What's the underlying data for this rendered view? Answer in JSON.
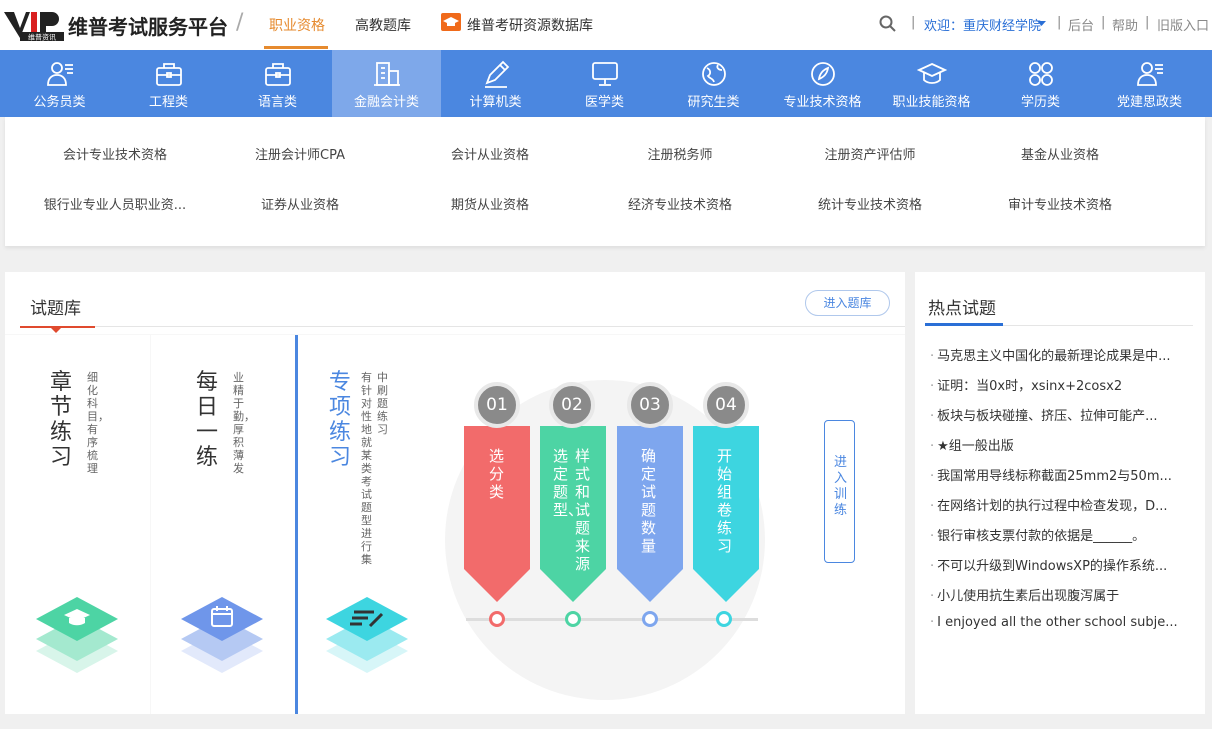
{
  "header": {
    "logo_text": "VIP",
    "logo_sub": "维普资讯",
    "site_name": "维普考试服务平台",
    "nav": [
      "职业资格",
      "高教题库",
      "维普考研资源数据库"
    ],
    "welcome": "欢迎：重庆财经学院",
    "links": [
      "后台",
      "帮助",
      "旧版入口"
    ]
  },
  "categories": [
    "公务员类",
    "工程类",
    "语言类",
    "金融会计类",
    "计算机类",
    "医学类",
    "研究生类",
    "专业技术资格",
    "职业技能资格",
    "学历类",
    "党建思政类"
  ],
  "subcategories": [
    "会计专业技术资格",
    "注册会计师CPA",
    "会计从业资格",
    "注册税务师",
    "注册资产评估师",
    "基金从业资格",
    "银行业专业人员职业资...",
    "证券从业资格",
    "期货从业资格",
    "经济专业技术资格",
    "统计专业技术资格",
    "审计专业技术资格"
  ],
  "question_bank": {
    "title": "试题库",
    "enter_label": "进入题库",
    "cards": [
      {
        "title": "章节练习",
        "desc": "细化科目，有序梳理"
      },
      {
        "title": "每日一练",
        "desc": "业精于勤，厚积薄发"
      },
      {
        "title": "专项练习",
        "desc1": "有针对性地就某类考试题型进行集",
        "desc2": "中刷题练习"
      }
    ],
    "steps": [
      {
        "num": "01",
        "col1": "选分类",
        "col2": "",
        "color": "#f26b6b"
      },
      {
        "num": "02",
        "col1": "选定题型、",
        "col2": "样式和试题来源",
        "color": "#4dd4a4"
      },
      {
        "num": "03",
        "col1": "确定试题数量",
        "col2": "",
        "color": "#7ea6ee"
      },
      {
        "num": "04",
        "col1": "开始组卷练习",
        "col2": "",
        "color": "#3dd5e0"
      }
    ],
    "enter_train": "进入训练"
  },
  "hot": {
    "title": "热点试题",
    "items": [
      "马克思主义中国化的最新理论成果是中...",
      "证明：当0x时，xsinx+2cosx2",
      "板块与板块碰撞、挤压、拉伸可能产...",
      "★组一般出版",
      "我国常用导线标称截面25mm2与50m...",
      "在网络计划的执行过程中检查发现，D...",
      "银行审核支票付款的依据是______。",
      "不可以升级到WindowsXP的操作系统...",
      "小儿使用抗生素后出现腹泻属于",
      "I enjoyed all the other school subje..."
    ]
  }
}
